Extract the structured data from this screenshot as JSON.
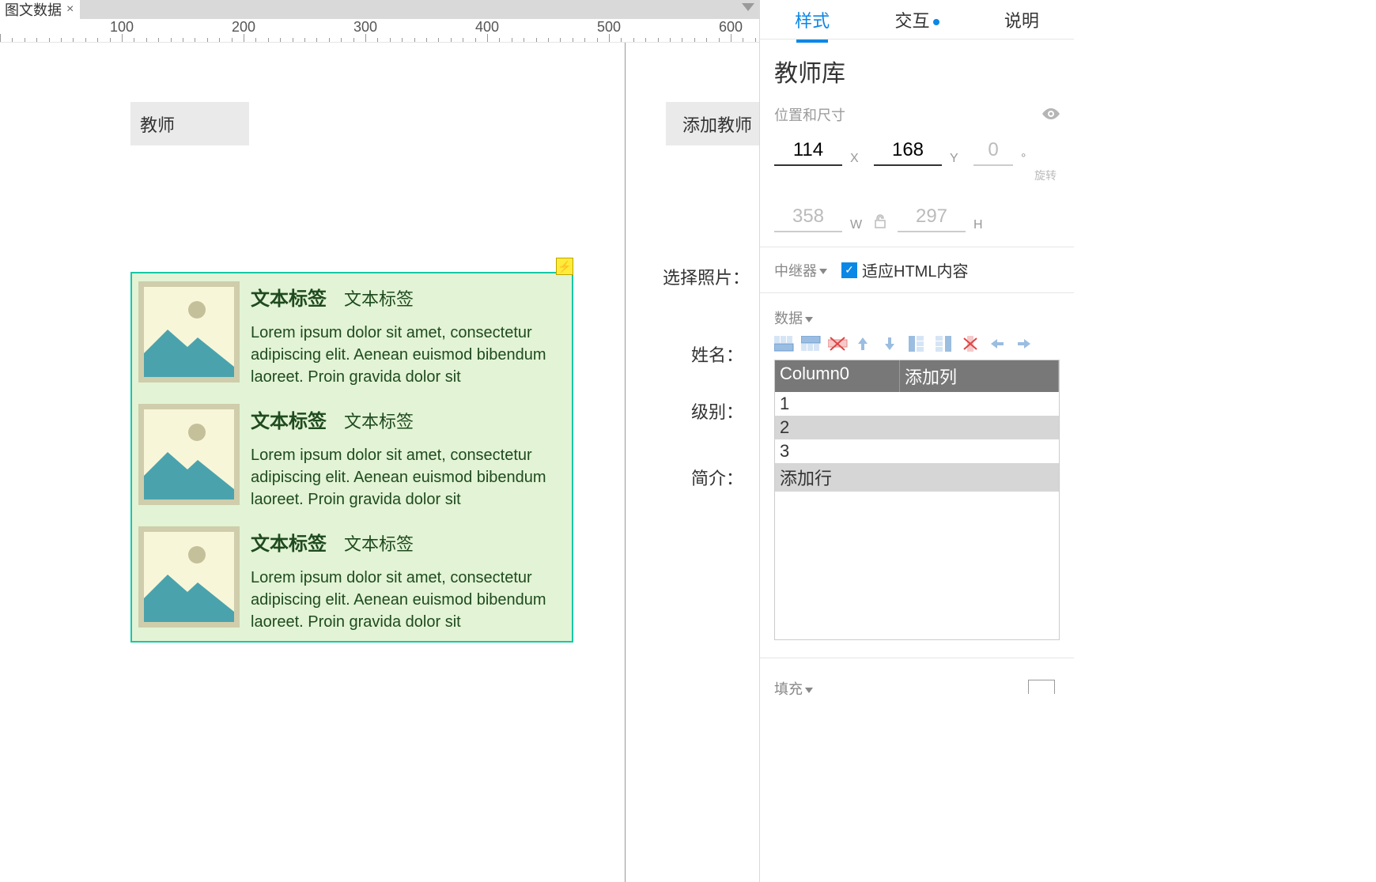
{
  "tab": {
    "name": "图文数据"
  },
  "ruler_marks": [
    100,
    200,
    300,
    400,
    500,
    600
  ],
  "canvas": {
    "teacher_label": "教师",
    "add_teacher": "添加教师",
    "select_photo": "选择照片：",
    "name_label": "姓名：",
    "level_label": "级别：",
    "intro_label": "简介：",
    "items": [
      {
        "title": "文本标签",
        "sub": "文本标签",
        "body": "Lorem ipsum dolor sit amet, consectetur adipiscing elit. Aenean euismod bibendum laoreet. Proin gravida dolor sit"
      },
      {
        "title": "文本标签",
        "sub": "文本标签",
        "body": "Lorem ipsum dolor sit amet, consectetur adipiscing elit. Aenean euismod bibendum laoreet. Proin gravida dolor sit"
      },
      {
        "title": "文本标签",
        "sub": "文本标签",
        "body": "Lorem ipsum dolor sit amet, consectetur adipiscing elit. Aenean euismod bibendum laoreet. Proin gravida dolor sit"
      }
    ]
  },
  "panel": {
    "tabs": {
      "style": "样式",
      "interact": "交互",
      "desc": "说明"
    },
    "title": "教师库",
    "position_section": "位置和尺寸",
    "x": "114",
    "y": "168",
    "rot": "0",
    "rot_label": "旋转",
    "w": "358",
    "h": "297",
    "repeater_label": "中继器",
    "fit_html": "适应HTML内容",
    "data_label": "数据",
    "table": {
      "col0": "Column0",
      "add_col": "添加列",
      "rows": [
        "1",
        "2",
        "3"
      ],
      "add_row": "添加行"
    },
    "fill_label": "填充"
  }
}
